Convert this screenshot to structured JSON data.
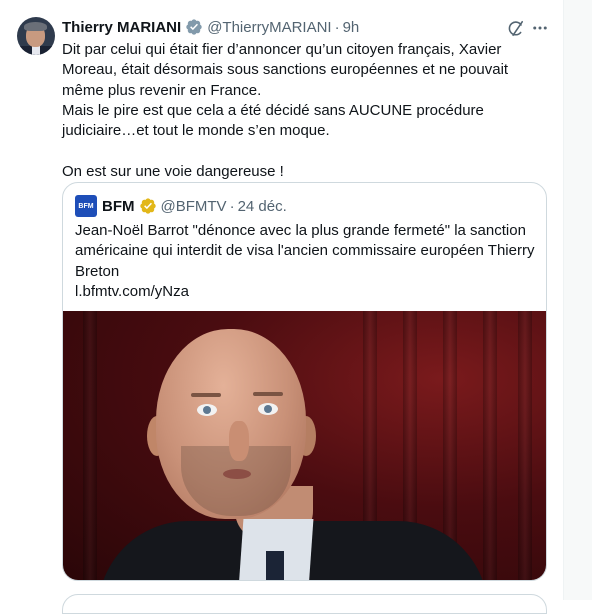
{
  "tweet": {
    "display_name": "Thierry MARIANI",
    "handle": "@ThierryMARIANI",
    "separator": "·",
    "time": "9h",
    "text": "Dit par celui qui était fier d’annoncer qu’un citoyen français, Xavier Moreau, était désormais sous sanctions européennes et ne pouvait même plus revenir en France.\nMais le pire est que cela a été décidé sans AUCUNE procédure judiciaire…et tout le monde s’en moque.\n\nOn est sur une voie dangereuse !",
    "verified_color": "#829aab",
    "icons": {
      "grok": "grok-icon",
      "more": "more-icon",
      "verified": "verified-badge-icon"
    }
  },
  "quote": {
    "logo_text": "BFM",
    "display_name": "BFM",
    "handle": "@BFMTV",
    "separator": "·",
    "time": "24 déc.",
    "text": "Jean-Noël Barrot \"dénonce avec la plus grande fermeté\" la sanction américaine qui interdit de visa l'ancien commissaire européen Thierry Breton\nl.bfmtv.com/yNza",
    "verified_color": "#e2b719",
    "logo_color": "#1e4eb8"
  }
}
